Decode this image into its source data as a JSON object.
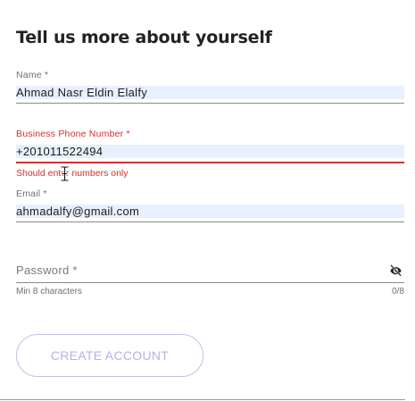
{
  "form": {
    "heading": "Tell us more about yourself",
    "name": {
      "label": "Name *",
      "value": "Ahmad Nasr Eldin Elalfy"
    },
    "phone": {
      "label": "Business Phone Number *",
      "value": "+201011522494",
      "error": "Should enter numbers only"
    },
    "email": {
      "label": "Email *",
      "value": "ahmadalfy@gmail.com"
    },
    "password": {
      "placeholder": "Password *",
      "hint": "Min 8 characters",
      "counter": "0/8",
      "toggle_icon": "eye-off-icon"
    },
    "submit_label": "CREATE ACCOUNT"
  },
  "colors": {
    "error": "#d32f2f",
    "autofill_bg": "#e8f0fe",
    "button_text": "#b6b1e4",
    "button_border": "#c3bfe6"
  }
}
